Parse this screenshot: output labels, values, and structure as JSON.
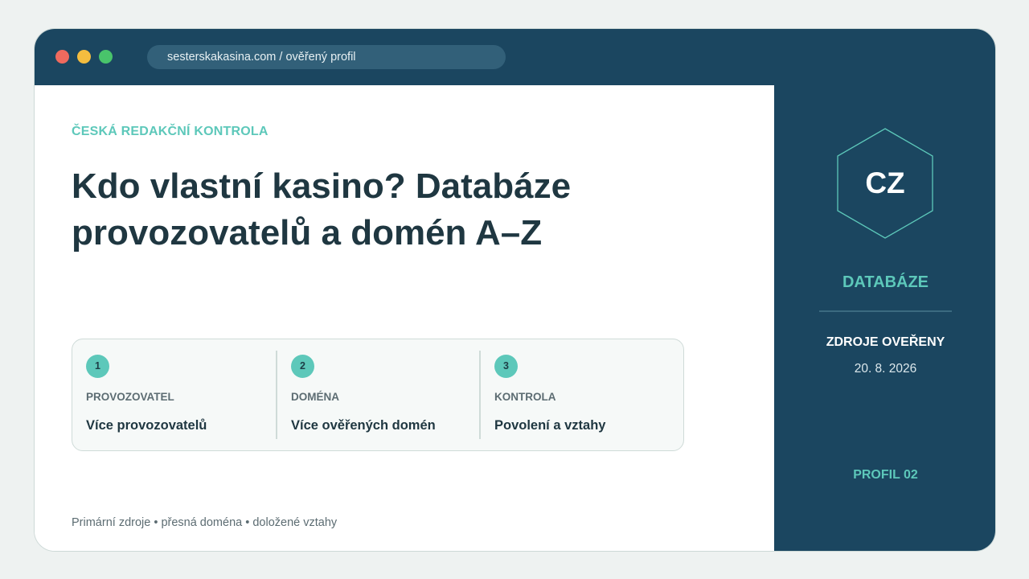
{
  "browser": {
    "address": "sesterskakasina.com / ověřený profil",
    "traffic_lights": {
      "close": "#ef6a5e",
      "minimize": "#f4bd3f",
      "maximize": "#49c46b"
    }
  },
  "main": {
    "eyebrow": "ČESKÁ REDAKČNÍ KONTROLA",
    "headline": "Kdo vlastní kasino? Databáze provozovatelů a domén A–Z",
    "cards": [
      {
        "number": "1",
        "label": "PROVOZOVATEL",
        "value": "Více provozovatelů"
      },
      {
        "number": "2",
        "label": "DOMÉNA",
        "value": "Více ověřených domén"
      },
      {
        "number": "3",
        "label": "KONTROLA",
        "value": "Povolení a vztahy"
      }
    ],
    "footer": "Primární zdroje • přesná doména • doložené vztahy"
  },
  "sidebar": {
    "badge": "CZ",
    "title": "DATABÁZE",
    "sources_label": "ZDROJE OVEŘENY",
    "date": "20. 8. 2026",
    "profile": "PROFIL 02"
  },
  "colors": {
    "navy": "#1b4660",
    "accent": "#5dc8ba",
    "text_dark": "#1f3741",
    "text_muted": "#5c6c72",
    "background": "#eef2f1"
  }
}
